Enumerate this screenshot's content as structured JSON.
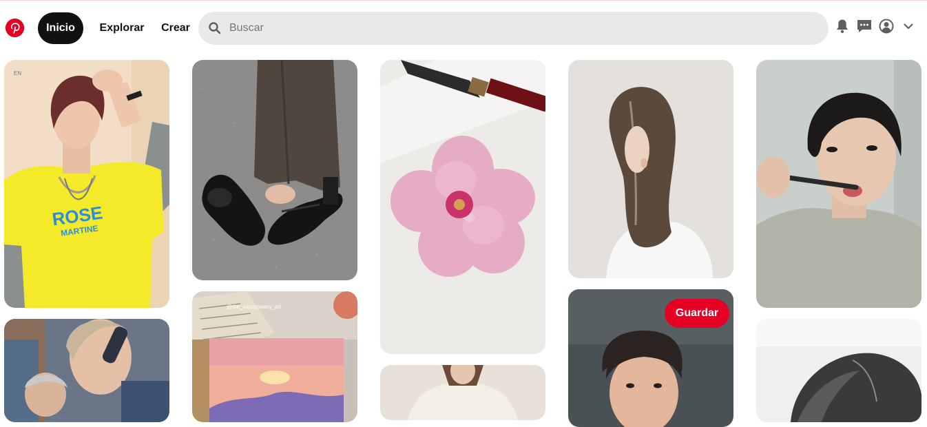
{
  "header": {
    "nav": {
      "home_label": "Inicio",
      "explore_label": "Explorar",
      "create_label": "Crear"
    },
    "search": {
      "placeholder": "Buscar",
      "value": ""
    },
    "icons": [
      "pinterest-logo-icon",
      "search-icon",
      "bell-icon",
      "message-icon",
      "profile-icon",
      "chevron-down-icon"
    ]
  },
  "grid": {
    "save_label": "Guardar",
    "pins": [
      {
        "name": "pin-yellow-shirt-person",
        "shirt_text_1": "ROSE",
        "shirt_text_2": "MARTINE",
        "corner_mark": "EN"
      },
      {
        "name": "pin-selfie-two-people"
      },
      {
        "name": "pin-black-mary-jane-shoes"
      },
      {
        "name": "pin-sunset-painting",
        "watermark": "@the_sassypeasy_art"
      },
      {
        "name": "pin-watercolor-pink-flower"
      },
      {
        "name": "pin-person-white-sweater"
      },
      {
        "name": "pin-layered-hair-profile"
      },
      {
        "name": "pin-young-man-dark-background"
      },
      {
        "name": "pin-man-brushing-teeth"
      },
      {
        "name": "pin-bw-hair-closeup"
      }
    ]
  },
  "colors": {
    "brand_red": "#e60023",
    "active_nav_bg": "#111111",
    "search_bg": "#e9e9e9"
  }
}
